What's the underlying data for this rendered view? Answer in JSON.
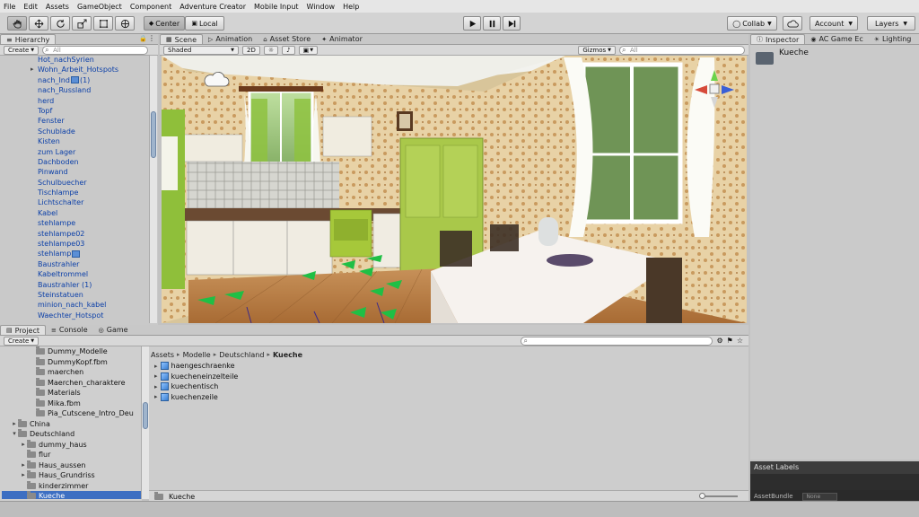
{
  "menubar": [
    "File",
    "Edit",
    "Assets",
    "GameObject",
    "Component",
    "Adventure Creator",
    "Mobile Input",
    "Window",
    "Help"
  ],
  "toolbar": {
    "tools": [
      "hand-tool",
      "move-tool",
      "rotate-tool",
      "scale-tool",
      "rect-tool",
      "transform-tool"
    ],
    "center_label": "Center",
    "local_label": "Local",
    "collab_label": "Collab",
    "account_label": "Account",
    "layers_label": "Layers"
  },
  "hierarchy": {
    "tab": "Hierarchy",
    "create": "Create",
    "search_placeholder": "All",
    "items": [
      {
        "label": "Hot_nachSyrien"
      },
      {
        "label": "Wohn_Arbeit_Hotspots",
        "arrow": true
      },
      {
        "label": "nach_Ind",
        "suffix": "(1)",
        "icon": true
      },
      {
        "label": "nach_Russland"
      },
      {
        "label": "herd"
      },
      {
        "label": "Topf"
      },
      {
        "label": "Fenster"
      },
      {
        "label": "Schublade"
      },
      {
        "label": "Kisten"
      },
      {
        "label": "zum Lager"
      },
      {
        "label": "Dachboden"
      },
      {
        "label": "Pinwand"
      },
      {
        "label": "Schulbuecher"
      },
      {
        "label": "Tischlampe"
      },
      {
        "label": "Lichtschalter"
      },
      {
        "label": "Kabel"
      },
      {
        "label": "stehlampe"
      },
      {
        "label": "stehlampe02"
      },
      {
        "label": "stehlampe03"
      },
      {
        "label": "stehlamp",
        "icon": true
      },
      {
        "label": "Baustrahler"
      },
      {
        "label": "Kabeltrommel"
      },
      {
        "label": "Baustrahler (1)"
      },
      {
        "label": "Steinstatuen"
      },
      {
        "label": "minion_nach_kabel"
      },
      {
        "label": "Waechter_Hotspot"
      }
    ]
  },
  "scene": {
    "tabs": [
      {
        "label": "Scene",
        "active": true
      },
      {
        "label": "Animation"
      },
      {
        "label": "Asset Store"
      },
      {
        "label": "Animator"
      }
    ],
    "shading": "Shaded",
    "mode_2d": "2D",
    "gizmos": "Gizmos",
    "search_placeholder": "All"
  },
  "inspector": {
    "tabs": [
      {
        "label": "Inspector",
        "active": true
      },
      {
        "label": "AC Game Ec"
      },
      {
        "label": "Lighting"
      }
    ],
    "object_name": "Kueche"
  },
  "project": {
    "tabs": [
      {
        "label": "Project",
        "active": true
      },
      {
        "label": "Console"
      },
      {
        "label": "Game"
      }
    ],
    "create": "Create",
    "tree": [
      {
        "label": "Dummy_Modelle",
        "indent": 3,
        "partial": true
      },
      {
        "label": "DummyKopf.fbm",
        "indent": 3
      },
      {
        "label": "maerchen",
        "indent": 3
      },
      {
        "label": "Maerchen_charaktere",
        "indent": 3
      },
      {
        "label": "Materials",
        "indent": 3
      },
      {
        "label": "Mika.fbm",
        "indent": 3
      },
      {
        "label": "Pia_Cutscene_Intro_Deu",
        "indent": 3
      },
      {
        "label": "China",
        "indent": 1,
        "arrow": "right"
      },
      {
        "label": "Deutschland",
        "indent": 1,
        "arrow": "down"
      },
      {
        "label": "dummy_haus",
        "indent": 2,
        "arrow": "right"
      },
      {
        "label": "flur",
        "indent": 2
      },
      {
        "label": "Haus_aussen",
        "indent": 2,
        "arrow": "right"
      },
      {
        "label": "Haus_Grundriss",
        "indent": 2,
        "arrow": "right"
      },
      {
        "label": "kinderzimmer",
        "indent": 2
      },
      {
        "label": "Kueche",
        "indent": 2,
        "selected": true
      }
    ],
    "breadcrumb": [
      "Assets",
      "Modelle",
      "Deutschland",
      "Kueche"
    ],
    "assets": [
      "haengeschraenke",
      "kuecheneinzelteile",
      "kuechentisch",
      "kuechenzeile"
    ],
    "footer_path": "Kueche",
    "asset_labels": "Asset Labels",
    "asset_bundle": "AssetBundle",
    "asset_bundle_value": "None"
  }
}
